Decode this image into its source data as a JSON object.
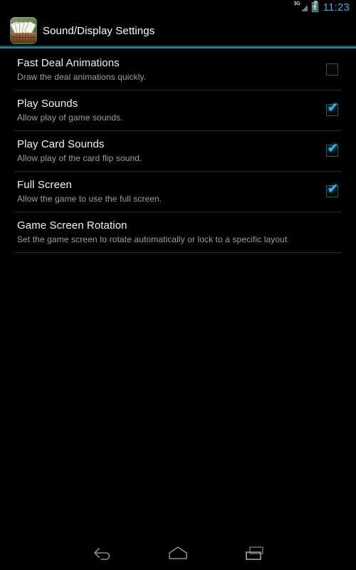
{
  "status_bar": {
    "network_label": "3G",
    "signal_icon": "signal-triangle-icon",
    "battery_icon": "battery-charging-icon",
    "time": "11:23",
    "accent_color": "#33b5e5"
  },
  "title_bar": {
    "app_icon": "playing-cards-app-icon",
    "title": "Sound/Display Settings",
    "accent_color": "#2f7f96"
  },
  "settings": {
    "items": [
      {
        "title": "Fast Deal Animations",
        "summary": "Draw the deal animations quickly.",
        "widget": "checkbox",
        "checked": false
      },
      {
        "title": "Play Sounds",
        "summary": "Allow play of game sounds.",
        "widget": "checkbox",
        "checked": true
      },
      {
        "title": "Play Card Sounds",
        "summary": "Allow play of the card flip sound.",
        "widget": "checkbox",
        "checked": true
      },
      {
        "title": "Full Screen",
        "summary": "Allow the game to use the full screen.",
        "widget": "checkbox",
        "checked": true
      },
      {
        "title": "Game Screen Rotation",
        "summary": "Set the game screen to rotate automatically or lock to a specific layout",
        "widget": "none",
        "checked": false
      }
    ],
    "check_glyph": "✔",
    "check_color": "#33b5e5"
  },
  "nav_bar": {
    "back": "back-icon",
    "home": "home-icon",
    "recents": "recents-icon"
  }
}
